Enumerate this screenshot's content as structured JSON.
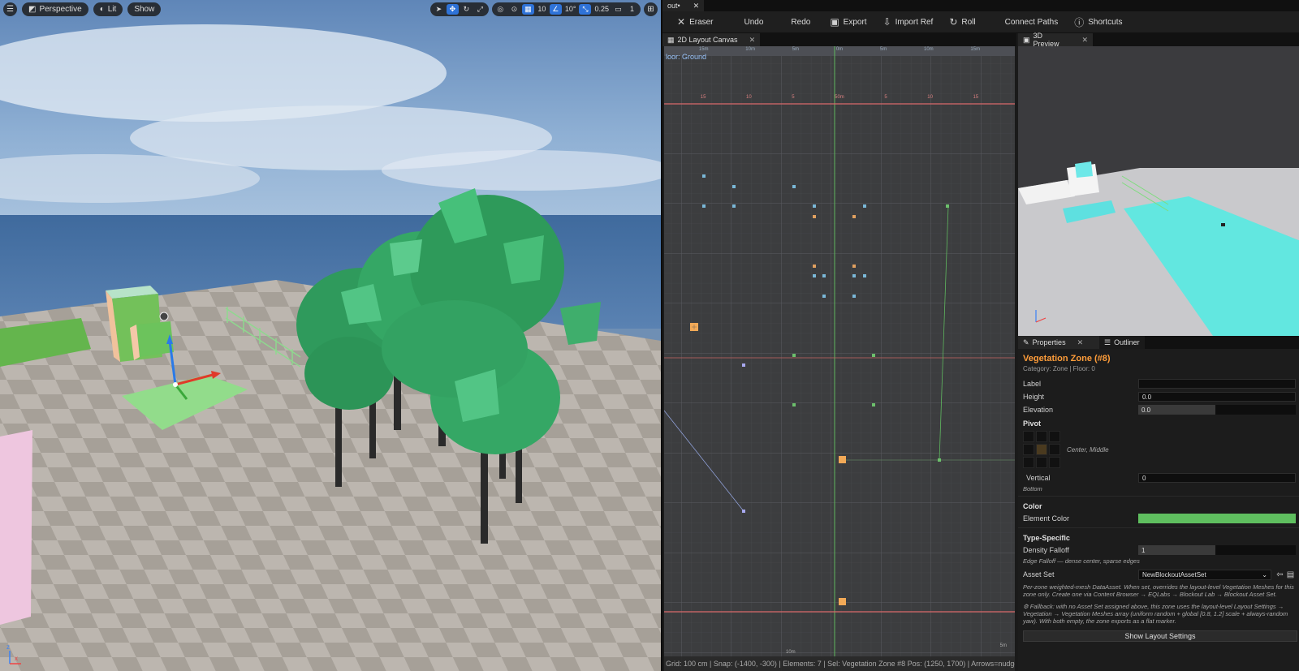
{
  "viewport": {
    "menu_icon": "hamburger-icon",
    "view_mode": "Perspective",
    "lighting": "Lit",
    "show": "Show",
    "grid_snap": "10",
    "rotation_snap": "10°",
    "scale_snap": "0.25",
    "camera_speed": "1"
  },
  "window": {
    "tab_title": "out•",
    "tab_close": "✕"
  },
  "toolbar": {
    "eraser": "Eraser",
    "undo": "Undo",
    "redo": "Redo",
    "export": "Export",
    "import_ref": "Import Ref",
    "roll": "Roll",
    "connect_paths": "Connect Paths",
    "shortcuts": "Shortcuts"
  },
  "canvas": {
    "tab": "2D Layout Canvas",
    "floor": "loor: Ground",
    "ruler_top": [
      "15m",
      "10m",
      "5m",
      "0m",
      "5m",
      "10m",
      "15m"
    ],
    "ruler_mid": [
      "15",
      "10",
      "5",
      "50m",
      "5",
      "10",
      "15"
    ],
    "scale_left": "10m",
    "scale_right": "5m",
    "status": "Grid: 100 cm | Snap: (-1400, -300) | Elements: 7 | Sel: Vegetation Zone #8  Pos: (1250, 1700) | Arrows=nudge  Enter=conf"
  },
  "preview": {
    "tab": "3D Preview"
  },
  "properties": {
    "tab": "Properties",
    "outliner_tab": "Outliner",
    "title": "Vegetation Zone  (#8)",
    "subtitle": "Category: Zone  |  Floor: 0",
    "label_lbl": "Label",
    "label_val": "",
    "height_lbl": "Height",
    "height_val": "0.0",
    "elevation_lbl": "Elevation",
    "elevation_val": "0.0",
    "pivot_lbl": "Pivot",
    "pivot_text": "Center, Middle",
    "vertical_lbl": "Vertical",
    "vertical_val": "0",
    "vertical_hint": "Bottom",
    "color_section": "Color",
    "element_color_lbl": "Element Color",
    "element_color": "#5fbf5f",
    "type_section": "Type-Specific",
    "density_lbl": "Density Falloff",
    "density_val": "1",
    "density_hint": "Edge Falloff — dense center, sparse edges",
    "asset_set_lbl": "Asset Set",
    "asset_set_val": "NewBlockoutAssetSet",
    "asset_hint": "Per-zone weighted-mesh DataAsset. When set, overrides the layout-level Vegetation Meshes for this zone only. Create one via Content Browser → EQLabs → Blockout Lab → Blockout Asset Set.",
    "fallback_hint": "⚙ Fallback: with no Asset Set assigned above, this zone uses the layout-level Layout Settings → Vegetation → Vegetation Meshes array (uniform random + global [0.8, 1.2] scale + always-random yaw). With both empty, the zone exports as a flat marker.",
    "show_layout": "Show Layout Settings"
  }
}
